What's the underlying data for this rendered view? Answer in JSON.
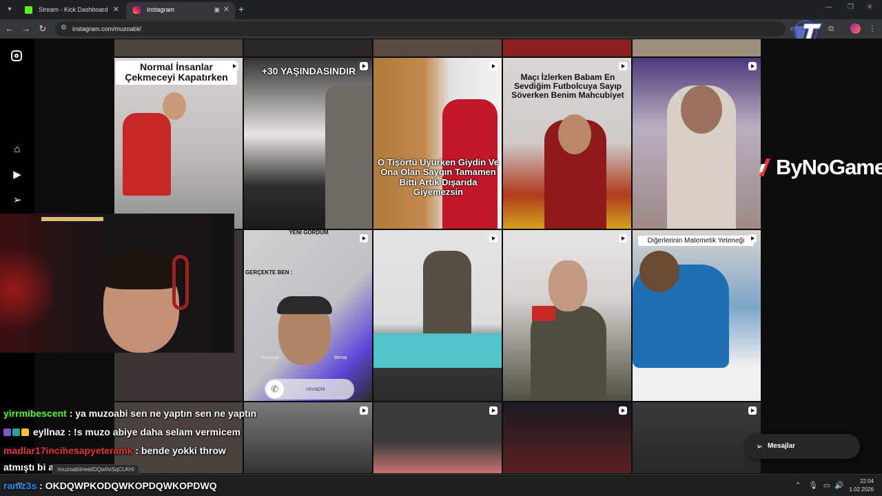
{
  "browser": {
    "tabs": [
      {
        "title": "Stream - Kick Dashboard",
        "favicon": "kick-icon",
        "active": false
      },
      {
        "title": "Instagram",
        "favicon": "instagram-icon",
        "active": true
      }
    ],
    "url": "instagram.com/muzoabii/",
    "status_url": "/muzoabii/reel/DQw0oSqCLKH/"
  },
  "instagram": {
    "sidebar_icons": [
      "instagram-logo-icon",
      "home-icon",
      "reels-icon",
      "send-icon"
    ],
    "posts": [
      {
        "caption": "Normal İnsanlar Çekmeceyi Kapatırken"
      },
      {
        "caption": "+30 YAŞINDASINDIR"
      },
      {
        "caption": "O Tişörtü Uyurken Giydin Ve Ona Olan Saygın Tamamen Bitti Artık Dışarıda Giyemezsin"
      },
      {
        "caption": "Maçı İzlerken Babam En Sevdiğim Futbolcuya Sayıp Söverken Benim Mahcubiyet"
      },
      {
        "caption": ""
      },
      {
        "caption": "YENİ GÖRDÜM",
        "caption2": "GERÇEKTE BEN :",
        "call_decline": "Anımsat",
        "call_message": "Mesaj",
        "call_accept": "cevapla"
      },
      {
        "caption": ""
      },
      {
        "caption": ""
      },
      {
        "caption": "Diğerlerinin Matemetik Yeteneği"
      }
    ],
    "messages_label": "Mesajlar"
  },
  "overlay": {
    "sponsor": "ByNoGame"
  },
  "chat": [
    {
      "user": "yirrmibescent",
      "color": "#53fc18",
      "text": ": ya muzoabi sen ne yaptın sen ne yaptın"
    },
    {
      "user": "eyllnaz",
      "color": "#ffffff",
      "text": ": !s muzo abiye daha selam vermicem"
    },
    {
      "user": "madlar17incihesapyeteramk",
      "color": "#e53935",
      "text": ": bende yokki throw"
    },
    {
      "user": "",
      "color": "#ffffff",
      "text": "atmıştı bi ara"
    },
    {
      "user": "ramz3s",
      "color": "#2196f3",
      "text": ": OKDQWPKODQWKOPDQWKOPDWQ"
    }
  ],
  "taskbar": {
    "time": "22:04",
    "date": "1.02.2026"
  }
}
